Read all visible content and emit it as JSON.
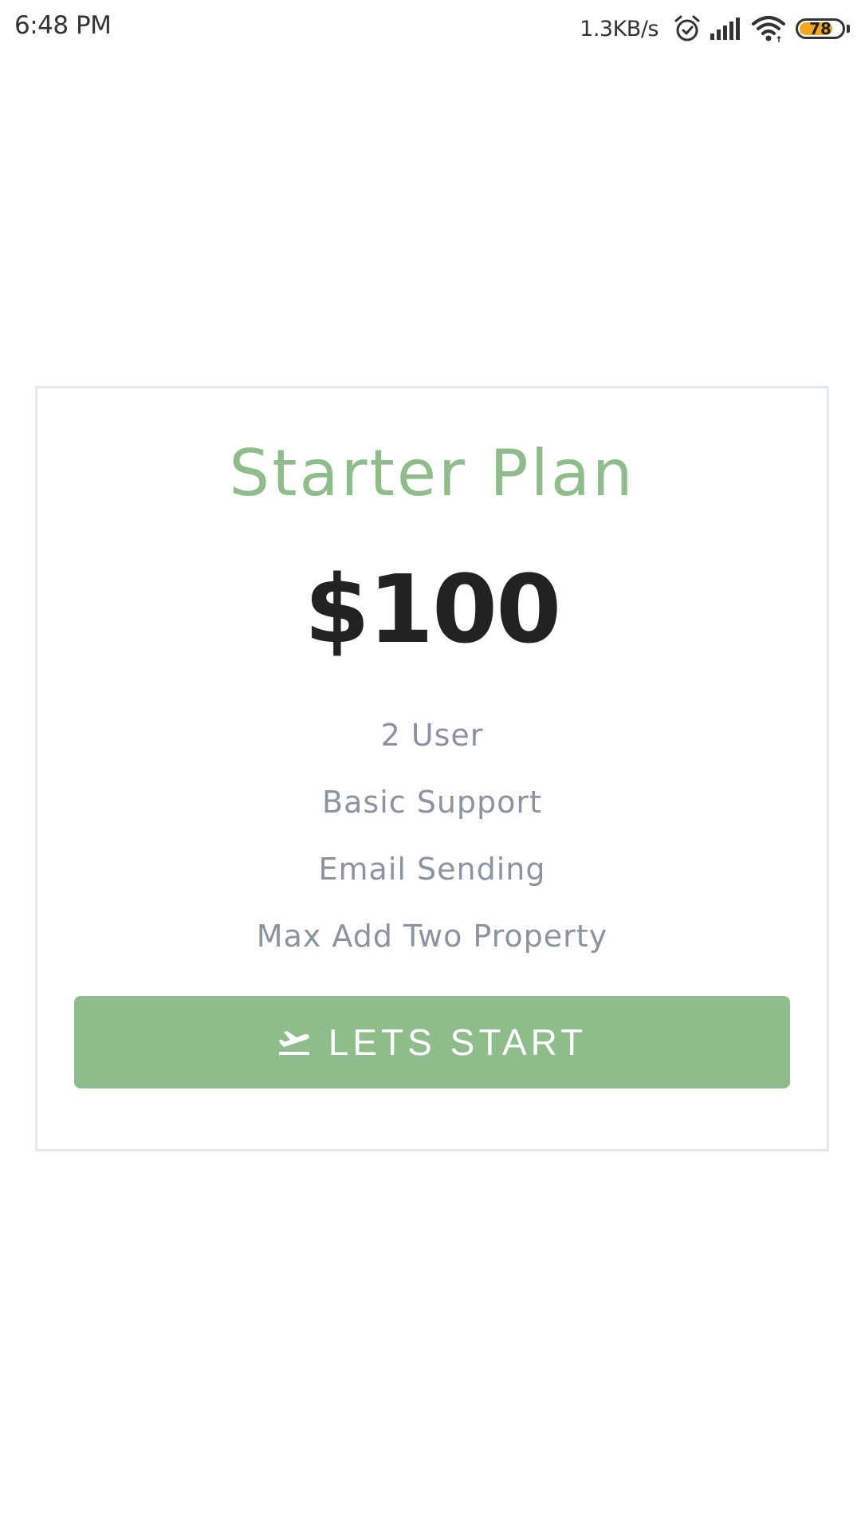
{
  "status_bar": {
    "time": "6:48 PM",
    "net_speed": "1.3KB/s",
    "battery_level": "78",
    "battery_fraction": 0.78,
    "icons": [
      "alarm-icon",
      "signal-icon",
      "wifi-icon",
      "battery-icon"
    ]
  },
  "plan": {
    "title": "Starter Plan",
    "price": "$100",
    "features": [
      "2 User",
      "Basic Support",
      "Email Sending",
      "Max Add Two Property"
    ],
    "button_label": "LETS START",
    "button_icon": "flight-takeoff-icon"
  },
  "colors": {
    "accent": "#8fbc8b",
    "price_text": "#222222",
    "feature_text": "#8a94a0",
    "card_border": "#e3e7ee",
    "battery": "#f5a623"
  }
}
